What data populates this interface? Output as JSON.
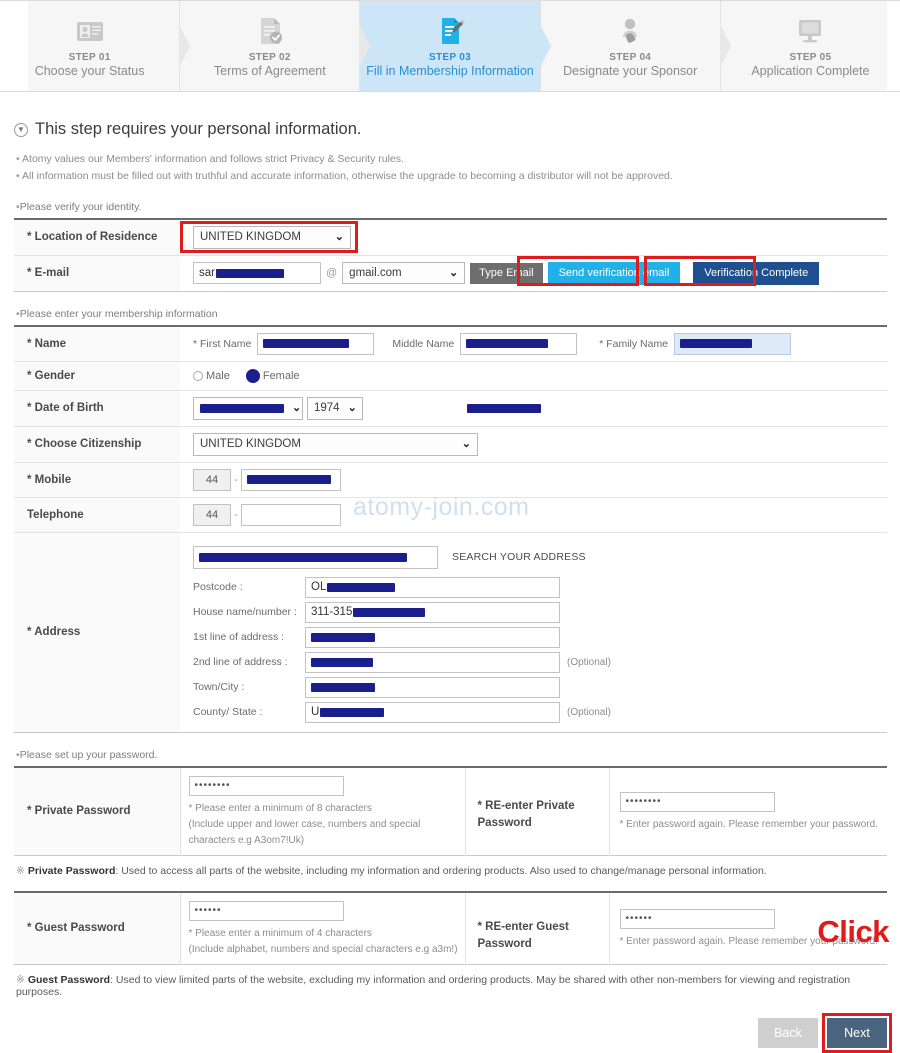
{
  "steps": [
    {
      "num": "STEP 01",
      "label": "Choose your Status",
      "icon": "id-card-icon",
      "active": false
    },
    {
      "num": "STEP 02",
      "label": "Terms of Agreement",
      "icon": "document-check-icon",
      "active": false
    },
    {
      "num": "STEP 03",
      "label": "Fill in Membership Information",
      "icon": "document-pen-icon",
      "active": true
    },
    {
      "num": "STEP 04",
      "label": "Designate your Sponsor",
      "icon": "person-hand-icon",
      "active": false
    },
    {
      "num": "STEP 05",
      "label": "Application Complete",
      "icon": "monitor-icon",
      "active": false
    }
  ],
  "heading": "This step requires your personal information.",
  "notices": [
    "Atomy values our Members' information and follows strict Privacy & Security rules.",
    "All information must be filled out with truthful and accurate information, otherwise the upgrade to becoming a distributor will not be approved."
  ],
  "identity": {
    "sub_head": "Please verify your identity.",
    "location_label": "* Location of Residence",
    "location_value": "UNITED KINGDOM",
    "email_label": "* E-mail",
    "email_local_value": "sar",
    "email_at": "@",
    "email_domain_value": "gmail.com",
    "type_email_label": "Type Email",
    "send_verification_label": "Send verification email",
    "verification_complete_label": "Verification Complete"
  },
  "membership": {
    "sub_head": "Please enter your membership information",
    "name_label": "* Name",
    "first_name_label": "* First Name",
    "middle_name_label": "Middle Name",
    "family_name_label": "* Family Name",
    "gender_label": "* Gender",
    "gender_male": "Male",
    "gender_female": "Female",
    "gender_selected": "Female",
    "dob_label": "* Date of Birth",
    "dob_year": "1974",
    "citizenship_label": "* Choose Citizenship",
    "citizenship_value": "UNITED KINGDOM",
    "mobile_label": "* Mobile",
    "mobile_prefix": "44",
    "telephone_label": "Telephone",
    "telephone_prefix": "44",
    "telephone_value": ""
  },
  "address": {
    "label": "* Address",
    "search_button_label": "SEARCH YOUR ADDRESS",
    "fields": [
      {
        "label": "Postcode :",
        "value_prefix": "OL",
        "optional": ""
      },
      {
        "label": "House name/number :",
        "value_prefix": "311-315",
        "optional": ""
      },
      {
        "label": "1st line of address :",
        "value_prefix": "",
        "optional": ""
      },
      {
        "label": "2nd line of address :",
        "value_prefix": "",
        "optional": "(Optional)"
      },
      {
        "label": "Town/City :",
        "value_prefix": "",
        "optional": ""
      },
      {
        "label": "County/ State :",
        "value_prefix": "U",
        "optional": "(Optional)"
      }
    ]
  },
  "password": {
    "sub_head": "Please set up your password.",
    "private_label": "* Private Password",
    "private_value": "••••••••",
    "private_hint_1": "* Please enter a minimum of 8 characters",
    "private_hint_2": "(Include upper and lower case, numbers and special",
    "private_hint_3": "characters e.g A3om7!Uk)",
    "private_reenter_label": "* RE-enter Private Password",
    "private_reenter_value": "••••••••",
    "reenter_hint": "* Enter password again. Please remember your password.",
    "private_note_title": "Private Password",
    "private_note_body": ": Used to access all parts of the website, including my information and ordering products. Also used to change/manage personal information.",
    "guest_label": "* Guest Password",
    "guest_value": "••••••",
    "guest_hint_1": "* Please enter a minimum of 4 characters",
    "guest_hint_2": "(Include alphabet, numbers and special characters e.g a3m!)",
    "guest_reenter_label": "* RE-enter Guest Password",
    "guest_reenter_value": "••••••",
    "guest_note_title": "Guest Password",
    "guest_note_body": ": Used to view limited parts of the website, excluding my information and ordering products. May be shared with other non-members for viewing and registration purposes."
  },
  "footer": {
    "back_label": "Back",
    "next_label": "Next"
  },
  "annotations": {
    "watermark": "atomy-join.com",
    "click_label": "Click"
  },
  "colors": {
    "active_step_bg": "#cde6f7",
    "active_step_text": "#2a8fd0",
    "cyan_button": "#22b0e8",
    "navy_button": "#1f4f8f",
    "grey_button": "#6e6e6e",
    "redaction": "#1b1f8c",
    "annotation_red": "#e01b1b",
    "next_button": "#4a6480"
  }
}
